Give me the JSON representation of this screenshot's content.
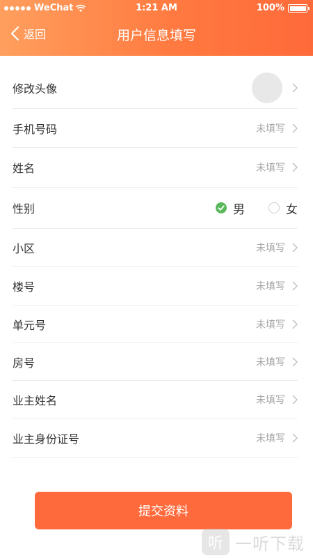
{
  "status_bar": {
    "carrier": "WeChat",
    "time": "1:21 AM",
    "battery": "100%"
  },
  "nav": {
    "back_label": "返回",
    "title": "用户信息填写"
  },
  "form": {
    "avatar_label": "修改头像",
    "rows": [
      {
        "label": "手机号码",
        "value": "未填写"
      },
      {
        "label": "姓名",
        "value": "未填写"
      }
    ],
    "gender": {
      "label": "性别",
      "options": [
        {
          "label": "男",
          "selected": true
        },
        {
          "label": "女",
          "selected": false
        }
      ]
    },
    "rows_after": [
      {
        "label": "小区",
        "value": "未填写"
      },
      {
        "label": "楼号",
        "value": "未填写"
      },
      {
        "label": "单元号",
        "value": "未填写"
      },
      {
        "label": "房号",
        "value": "未填写"
      },
      {
        "label": "业主姓名",
        "value": "未填写"
      },
      {
        "label": "业主身份证号",
        "value": "未填写"
      }
    ]
  },
  "submit_label": "提交资料",
  "watermark": {
    "logo_char": "听",
    "text": "一听下载"
  },
  "colors": {
    "header_start": "#ff9f5e",
    "header_end": "#ff6a3a",
    "accent": "#ff6a3c",
    "radio_checked": "#5cb85c",
    "placeholder_text": "#a6a6a6"
  }
}
